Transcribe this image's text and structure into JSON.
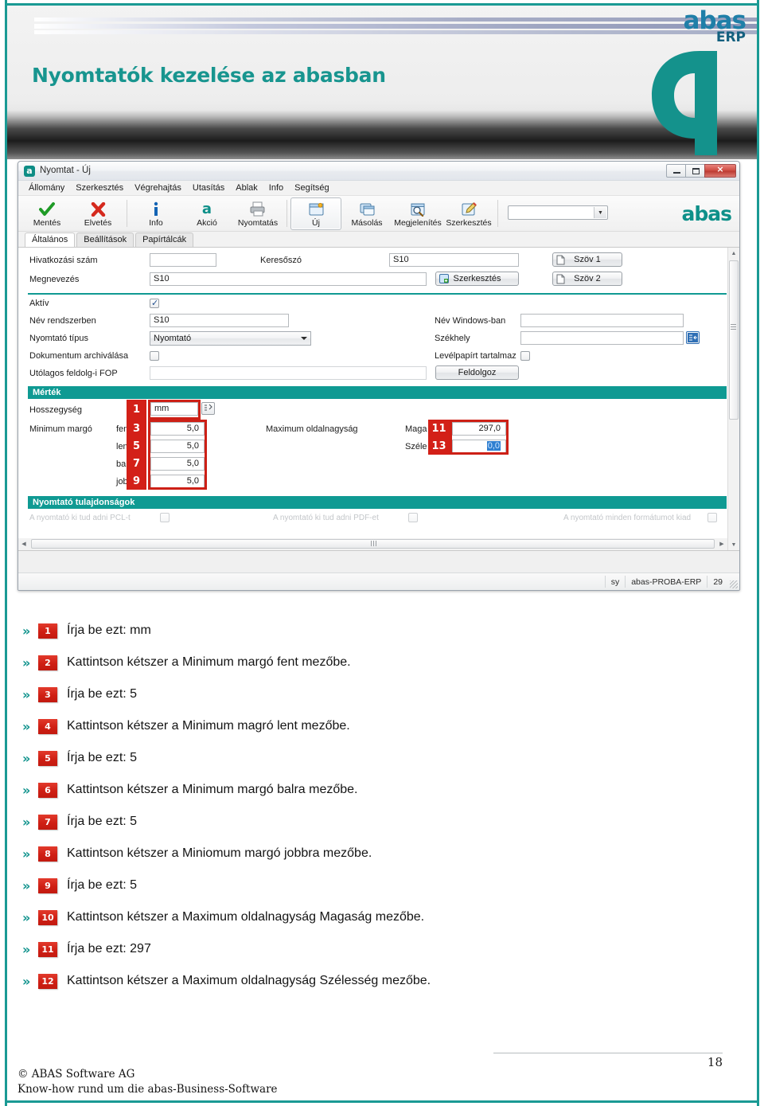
{
  "banner": {
    "title": "Nyomtatók kezelése az abasban",
    "logo_word": "abas",
    "logo_sub": "ERP",
    "mark_icon": "abas-a-mark-icon"
  },
  "window": {
    "title": "Nyomtat - Új",
    "app_icon": "abas-app-icon",
    "minimize_label": "Minimalizálás",
    "maximize_label": "Maximalizálás",
    "close_label": "×",
    "menu": [
      "Állomány",
      "Szerkesztés",
      "Végrehajtás",
      "Utasítás",
      "Ablak",
      "Info",
      "Segítség"
    ],
    "toolbar": {
      "buttons": [
        {
          "label": "Mentés",
          "icon": "check-icon"
        },
        {
          "label": "Elvetés",
          "icon": "cross-icon"
        },
        {
          "label": "Info",
          "icon": "info-icon"
        },
        {
          "label": "Akció",
          "icon": "abas-a-icon"
        },
        {
          "label": "Nyomtatás",
          "icon": "printer-icon"
        },
        {
          "label": "Új",
          "icon": "new-document-icon"
        },
        {
          "label": "Másolás",
          "icon": "copy-icon"
        },
        {
          "label": "Megjelenítés",
          "icon": "magnifier-icon"
        },
        {
          "label": "Szerkesztés",
          "icon": "pencil-edit-icon"
        }
      ],
      "selected": "Új",
      "combo_value": "",
      "brand": "abas"
    },
    "tabs": [
      {
        "label": "Általános",
        "active": true
      },
      {
        "label": "Beállítások",
        "active": false
      },
      {
        "label": "Papírtálcák",
        "active": false
      }
    ],
    "fields": {
      "hivatkozasi_szam_label": "Hivatkozási szám",
      "hivatkozasi_szam_value": "",
      "keresoszo_label": "Keresőszó",
      "keresoszo_value": "S10",
      "megnevezes_label": "Megnevezés",
      "megnevezes_value": "S10",
      "szerkesztes_button": "Szerkesztés",
      "szov1_button": "Szöv 1",
      "szov2_button": "Szöv 2",
      "aktiv_label": "Aktív",
      "aktiv_checked": true,
      "nev_rendszerben_label": "Név rendszerben",
      "nev_rendszerben_value": "S10",
      "nev_windows_label": "Név Windows-ban",
      "nev_windows_value": "",
      "nyomtato_tipus_label": "Nyomtató típus",
      "nyomtato_tipus_value": "Nyomtató",
      "szekhely_label": "Székhely",
      "szekhely_value": "",
      "dokumentum_archivalasa_label": "Dokumentum archiválása",
      "dokumentum_archivalasa_checked": false,
      "levelpapirt_tartalmaz_label": "Levélpapírt tartalmaz",
      "levelpapirt_tartalmaz_checked": false,
      "utolagos_fop_label": "Utólagos feldolg-i FOP",
      "utolagos_fop_value": "",
      "feldolgoz_button": "Feldolgoz"
    },
    "mertek": {
      "section_title": "Mérték",
      "hosszegyseg_label": "Hosszegység",
      "hosszegyseg_value": "mm",
      "minimum_margo_label": "Minimum margó",
      "rows": [
        {
          "label": "fent",
          "value": "5,0"
        },
        {
          "label": "lent",
          "value": "5,0"
        },
        {
          "label": "balra",
          "value": "5,0"
        },
        {
          "label": "jobbra",
          "value": "5,0"
        }
      ],
      "max_oldalnagysag_label": "Maximum oldalnagyság",
      "magassag_label": "Maga",
      "magassag_value": "297,0",
      "szelesseg_label": "Széle",
      "szelesseg_value": "0,0"
    },
    "tulajdonsagok": {
      "section_title": "Nyomtató tulajdonságok",
      "row": [
        "A nyomtató ki tud adni PCL-t",
        "A nyomtató ki tud adni PDF-et",
        "A nyomtató minden formátumot kiad"
      ]
    },
    "statusbar": {
      "user": "sy",
      "client": "abas-PROBA-ERP",
      "count": "29"
    },
    "callouts": [
      {
        "n": "1",
        "for": "hosszegyseg"
      },
      {
        "n": "3",
        "for": "minimum-margo-fent"
      },
      {
        "n": "5",
        "for": "minimum-margo-lent"
      },
      {
        "n": "7",
        "for": "minimum-margo-balra"
      },
      {
        "n": "9",
        "for": "minimum-margo-jobbra"
      },
      {
        "n": "11",
        "for": "maximum-magassag"
      },
      {
        "n": "13",
        "for": "maximum-szelesseg"
      }
    ]
  },
  "steps": [
    {
      "n": "1",
      "text": "Írja be ezt: mm"
    },
    {
      "n": "2",
      "text": "Kattintson kétszer a Minimum margó fent mezőbe."
    },
    {
      "n": "3",
      "text": "Írja be ezt: 5"
    },
    {
      "n": "4",
      "text": "Kattintson kétszer a Minimum magró lent mezőbe."
    },
    {
      "n": "5",
      "text": "Írja be ezt: 5"
    },
    {
      "n": "6",
      "text": "Kattintson kétszer a Minimum margó balra mezőbe."
    },
    {
      "n": "7",
      "text": "Írja be ezt: 5"
    },
    {
      "n": "8",
      "text": "Kattintson kétszer a Miniomum margó jobbra mezőbe."
    },
    {
      "n": "9",
      "text": "Írja be ezt: 5"
    },
    {
      "n": "10",
      "text": "Kattintson kétszer a Maximum oldalnagyság Magaság mezőbe."
    },
    {
      "n": "11",
      "text": "Írja be ezt: 297"
    },
    {
      "n": "12",
      "text": "Kattintson kétszer a Maximum oldalnagyság Szélesség mezőbe."
    }
  ],
  "footer": {
    "page_number": "18",
    "line1": "© ABAS Software AG",
    "line2": "Know-how rund um die abas-Business-Software"
  },
  "colors": {
    "teal": "#109a93",
    "callout_red": "#cd2016",
    "brand_blue": "#1f7fa8"
  }
}
